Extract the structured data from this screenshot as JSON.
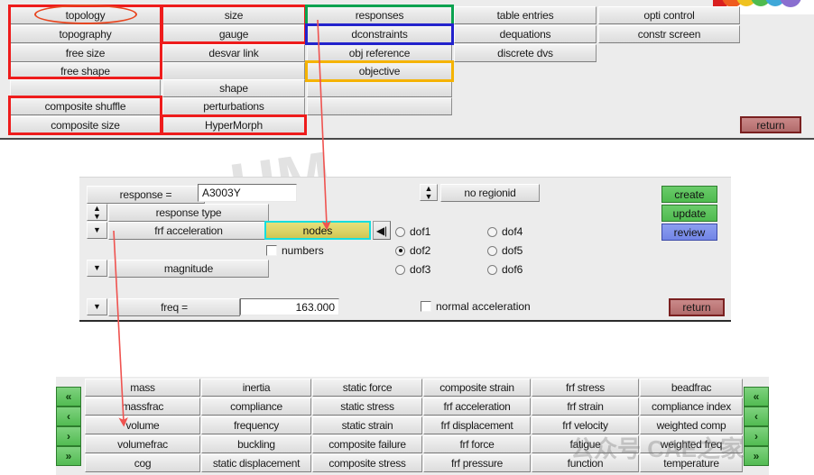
{
  "menu": {
    "columns": [
      {
        "items": [
          "topology",
          "topography",
          "free size",
          "free shape",
          "",
          "composite shuffle",
          "composite size"
        ]
      },
      {
        "items": [
          "size",
          "gauge",
          "desvar link",
          "",
          "shape",
          "perturbations",
          "HyperMorph"
        ]
      },
      {
        "items": [
          "responses",
          "dconstraints",
          "obj reference",
          "objective",
          "",
          "",
          ""
        ]
      },
      {
        "items": [
          "table entries",
          "dequations",
          "discrete dvs",
          "",
          "",
          "",
          ""
        ]
      },
      {
        "items": [
          "opti control",
          "constr screen",
          "",
          "",
          "",
          "",
          ""
        ]
      }
    ],
    "return_label": "return",
    "highlight_colors": {
      "red": "#ee1c1c",
      "green": "#0aa24f",
      "blue": "#2222cc",
      "orange": "#f5b301",
      "ellipse": "#e8451f",
      "arrow": "#ef5350"
    }
  },
  "panel": {
    "response_label": "response =",
    "response_value": "A3003Y",
    "response_type_label": "response type",
    "response_type_value": "frf acceleration",
    "magnitude_label": "magnitude",
    "freq_label": "freq =",
    "freq_value": "163.000",
    "entity_selector": "nodes",
    "numbers_label": "numbers",
    "numbers_checked": false,
    "regionid_label": "no regionid",
    "dofs": [
      {
        "label": "dof1",
        "selected": false
      },
      {
        "label": "dof2",
        "selected": true
      },
      {
        "label": "dof3",
        "selected": false
      },
      {
        "label": "dof4",
        "selected": false
      },
      {
        "label": "dof5",
        "selected": false
      },
      {
        "label": "dof6",
        "selected": false
      }
    ],
    "normal_acceleration_label": "normal acceleration",
    "normal_acceleration_checked": false,
    "create_label": "create",
    "update_label": "update",
    "review_label": "review",
    "return_label": "return",
    "colors": {
      "create": "#4fbb4f",
      "update": "#4fbb4f",
      "review": "#7285e6",
      "return": "#bf7a7a",
      "selector_highlight": "#17dede",
      "selector_fill": "#dbd264"
    }
  },
  "response_table": {
    "columns": [
      [
        "mass",
        "massfrac",
        "volume",
        "volumefrac",
        "cog"
      ],
      [
        "inertia",
        "compliance",
        "frequency",
        "buckling",
        "static displacement"
      ],
      [
        "static force",
        "static stress",
        "static strain",
        "composite failure",
        "composite stress"
      ],
      [
        "composite strain",
        "frf acceleration",
        "frf displacement",
        "frf force",
        "frf pressure"
      ],
      [
        "frf stress",
        "frf strain",
        "frf velocity",
        "fatigue",
        "function"
      ],
      [
        "beadfrac",
        "compliance index",
        "weighted comp",
        "weighted freq",
        "temperature"
      ]
    ],
    "nav": {
      "first": "«",
      "prev": "‹",
      "next": "›",
      "last": "»"
    }
  },
  "watermarks": {
    "center": "HM",
    "bottom_right": "公众号 CAE之家"
  }
}
